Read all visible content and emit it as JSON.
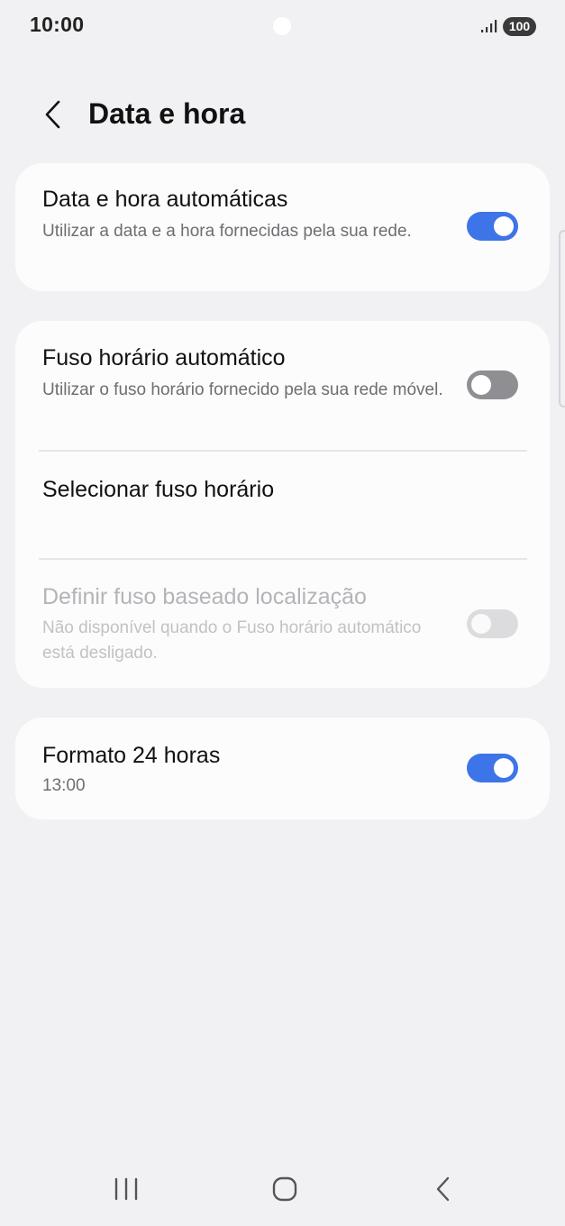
{
  "status_bar": {
    "time": "10:00",
    "battery": "100"
  },
  "header": {
    "title": "Data e hora"
  },
  "settings": {
    "auto_datetime": {
      "title": "Data e hora automáticas",
      "subtitle": "Utilizar a data e a hora fornecidas pela sua rede.",
      "enabled": true
    },
    "auto_timezone": {
      "title": "Fuso horário automático",
      "subtitle": "Utilizar o fuso horário fornecido pela sua rede móvel.",
      "enabled": false
    },
    "select_timezone": {
      "title": "Selecionar fuso horário"
    },
    "location_timezone": {
      "title": "Definir fuso baseado localização",
      "subtitle": "Não disponível quando o Fuso horário automático está desligado.",
      "enabled": false,
      "available": false
    },
    "format_24h": {
      "title": "Formato 24 horas",
      "subtitle": "13:00",
      "enabled": true
    }
  },
  "colors": {
    "background": "#f1f1f3",
    "card": "#fcfcfd",
    "accent": "#3d74e8",
    "toggle_off": "#8f8f93"
  },
  "icons": {
    "back": "chevron-left-icon",
    "signal": "signal-bars-icon",
    "nav_recents": "recents-icon",
    "nav_home": "home-icon",
    "nav_back": "back-icon"
  }
}
